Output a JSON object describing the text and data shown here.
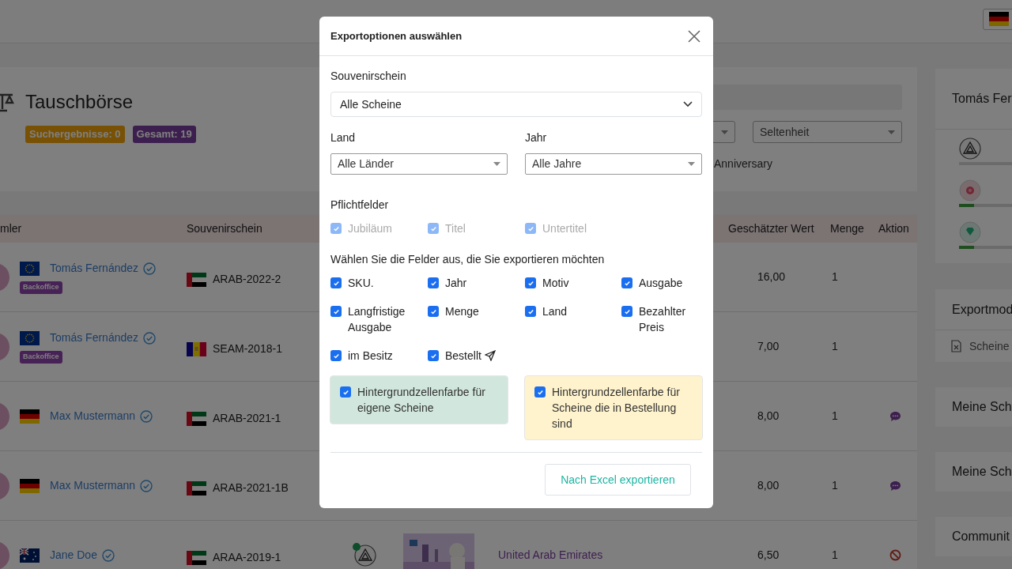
{
  "top_bar": {
    "language_flag": {
      "kind": "de"
    }
  },
  "header": {
    "title": "Tauschbörse",
    "badges": [
      {
        "text": "Suchergebnisse: 0",
        "kind": "results"
      },
      {
        "text": "Gesamt: 19",
        "kind": "total"
      }
    ],
    "rarity_select": "Seltenheit",
    "option_label": "Anniversary"
  },
  "table": {
    "columns": [
      "mler",
      "Souvenirschein",
      "Geschätzter Wert",
      "Menge",
      "Aktion"
    ],
    "rows": [
      {
        "name": "Tomás Fernández",
        "flag": {
          "kind": "eu"
        },
        "verified": true,
        "badge": "Backoffice",
        "sku": "ARAB-2022-2",
        "sku_flag": {
          "kind": "ae"
        },
        "value": "16,00",
        "qty": "1"
      },
      {
        "name": "Tomás Fernández",
        "flag": {
          "kind": "eu"
        },
        "verified": true,
        "badge": "Backoffice",
        "sku": "SEAM-2018-1",
        "sku_flag": {
          "kind": "ad"
        },
        "value": "7,00",
        "qty": "1"
      },
      {
        "name": "Max Mustermann",
        "flag": {
          "kind": "de"
        },
        "verified": true,
        "sku": "ARAB-2021-1",
        "sku_flag": {
          "kind": "ae"
        },
        "value": "8,00",
        "qty": "1",
        "action": {
          "kind": "chat"
        }
      },
      {
        "name": "Max Mustermann",
        "flag": {
          "kind": "de"
        },
        "verified": true,
        "sku": "ARAB-2021-1B",
        "sku_flag": {
          "kind": "ae"
        },
        "value": "8,00",
        "qty": "1",
        "action": {
          "kind": "chat"
        }
      },
      {
        "name": "Jane Doe",
        "flag": {
          "kind": "au"
        },
        "verified": true,
        "sku": "ARAA-2019-1",
        "sku_flag": {
          "kind": "ae"
        },
        "online": true,
        "country": "United Arab Emirates",
        "value": "6,50",
        "qty": "1",
        "action": {
          "kind": "blocked"
        }
      }
    ]
  },
  "sidebar": {
    "profile": {
      "title": "Tomás Fer",
      "ranks": [
        {
          "kind": "triangle"
        },
        {
          "kind": "flower",
          "level": 0.08
        },
        {
          "kind": "diamond",
          "level": 0.08
        }
      ]
    },
    "export_card": {
      "title": "Exportmod",
      "item": "Scheine"
    },
    "cards": [
      {
        "title": "Meine Sch"
      },
      {
        "title": "Meine Sch"
      },
      {
        "title": "Communit"
      }
    ]
  },
  "dialog": {
    "title": "Exportoptionen auswählen",
    "souvenir": {
      "label": "Souvenirschein",
      "value": "Alle Scheine"
    },
    "land": {
      "label": "Land",
      "value": "Alle Länder"
    },
    "jahr": {
      "label": "Jahr",
      "value": "Alle Jahre"
    },
    "required": {
      "label": "Pflichtfelder",
      "fields": [
        {
          "label": "Jubiläum",
          "checked": true,
          "disabled": true
        },
        {
          "label": "Titel",
          "checked": true,
          "disabled": true
        },
        {
          "label": "Untertitel",
          "checked": true,
          "disabled": true
        }
      ]
    },
    "fields_label": "Wählen Sie die Felder aus, die Sie exportieren möchten",
    "fields": [
      {
        "label": "SKU.",
        "checked": true,
        "kind": "plain"
      },
      {
        "label": "Jahr",
        "checked": true,
        "kind": "plain"
      },
      {
        "label": "Motiv",
        "checked": true,
        "kind": "plain"
      },
      {
        "label": "Ausgabe",
        "checked": true,
        "kind": "plain"
      },
      {
        "label": "Langfristige Ausgabe",
        "checked": true,
        "kind": "plain"
      },
      {
        "label": "Menge",
        "checked": true,
        "kind": "plain"
      },
      {
        "label": "Land",
        "checked": true,
        "kind": "plain"
      },
      {
        "label": "Bezahlter Preis",
        "checked": true,
        "kind": "plain"
      },
      {
        "label": "im Besitz",
        "checked": true,
        "kind": "plain"
      },
      {
        "label": "Bestellt",
        "checked": true,
        "kind": "ordered"
      }
    ],
    "color_options": [
      {
        "label": "Hintergrundzellenfarbe für eigene Scheine",
        "checked": true,
        "color": "#d1e7dd"
      },
      {
        "label": "Hintergrundzellenfarbe für Scheine die in Bestellung sind",
        "checked": true,
        "color": "#fff3cd"
      }
    ],
    "export_button": "Nach Excel exportieren"
  }
}
